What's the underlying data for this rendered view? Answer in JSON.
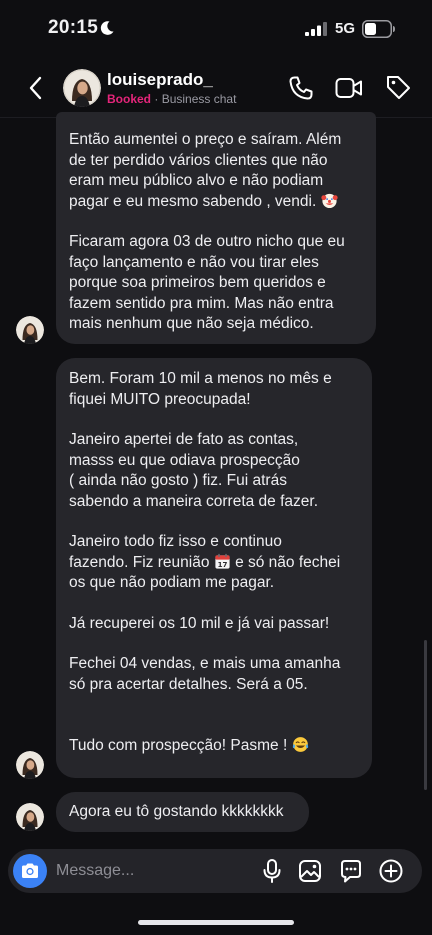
{
  "status_bar": {
    "time": "20:15",
    "network": "5G"
  },
  "header": {
    "contact_name": "louiseprado_",
    "status_tag": "Booked",
    "separator": "·",
    "subtitle": "Business chat"
  },
  "messages": [
    {
      "paragraphs": [
        "Então aumentei o preço e saíram. Além\nde ter perdido vários clientes que não\neram meu público alvo  e não podiam\npagar e eu mesmo sabendo , vendi.",
        "Ficaram agora 03 de outro nicho que eu\nfaço lançamento e não vou tirar eles\nporque soa primeiros bem queridos e\nfazem sentido pra mim. Mas não entra\nmais nenhum que não seja médico."
      ]
    },
    {
      "paragraphs": [
        "Bem. Foram 10 mil a menos no mês e\nfiquei MUITO preocupada!",
        "Janeiro apertei de fato as contas,\nmasss eu que odiava prospecção\n( ainda não gosto ) fiz. Fui atrás\nsabendo a maneira correta de fazer.",
        "Janeiro todo fiz isso e continuo\nfazendo. Fiz reunião",
        "e só não fechei\nos que não podiam me pagar.",
        "Já recuperei os 10 mil e já vai passar!",
        "Fechei 04 vendas, e mais uma amanha\nsó pra acertar detalhes. Será a 05.",
        "Tudo com prospecção! Pasme !"
      ]
    },
    {
      "paragraphs": [
        "Agora eu tô gostando kkkkkkkk"
      ]
    }
  ],
  "composer": {
    "placeholder": "Message..."
  },
  "icons": {
    "status": [
      "moon-icon",
      "signal-icon",
      "battery-icon"
    ],
    "header": [
      "back-icon",
      "phone-icon",
      "video-icon",
      "tag-icon"
    ],
    "emoji": [
      "clown-emoji-icon",
      "calendar-emoji-icon",
      "tears-of-joy-emoji-icon"
    ],
    "composer": [
      "camera-icon",
      "mic-icon",
      "gallery-icon",
      "sticker-icon",
      "plus-icon"
    ]
  },
  "colors": {
    "background": "#0e0e11",
    "bubble": "#26262b",
    "booked": "#e4257a",
    "camera_button": "#3b82f6",
    "composer": "#242429"
  }
}
